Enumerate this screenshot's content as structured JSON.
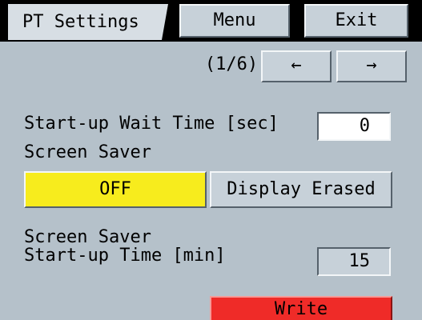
{
  "header": {
    "title": "PT Settings",
    "menu_label": "Menu",
    "exit_label": "Exit"
  },
  "pager": {
    "indicator": "(1/6)",
    "prev_label": "←",
    "next_label": "→"
  },
  "startup_wait": {
    "label": "Start-up Wait Time [sec]",
    "value": "0"
  },
  "screen_saver": {
    "label": "Screen Saver",
    "options": [
      "OFF",
      "Display Erased"
    ],
    "selected": "OFF",
    "selected_color": "#f7ec1d"
  },
  "screen_saver_time": {
    "label_line1": "Screen Saver",
    "label_line2": "Start-up Time [min]",
    "value": "15"
  },
  "write": {
    "label": "Write",
    "color": "#ef2b28"
  }
}
